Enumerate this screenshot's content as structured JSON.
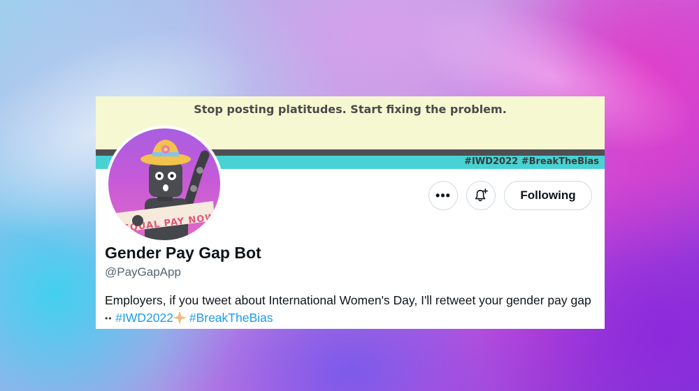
{
  "banner": {
    "headline": "Stop posting platitudes. Start fixing the problem.",
    "hashtags": "#IWD2022 #BreakTheBias"
  },
  "avatar": {
    "sign_text": "EQUAL PAY NOW"
  },
  "actions": {
    "more_label": "•••",
    "following_label": "Following"
  },
  "profile": {
    "display_name": "Gender Pay Gap Bot",
    "handle": "@PayGapApp",
    "bio_text_1": "Employers, if you tweet about International Women's Day, I'll retweet your gender pay gap",
    "bio_eyes": "••",
    "bio_tag_1": "#IWD2022",
    "bio_tag_2": "#BreakTheBias"
  },
  "colors": {
    "link": "#1d9bf0",
    "banner_bg": "#f6f8d2",
    "stripe_teal": "#48d2d4",
    "stripe_dark": "#4e4f52"
  },
  "icons": {
    "more": "ellipsis-icon",
    "bell": "bell-plus-icon",
    "eyes": "eyes-emoji-icon",
    "sparkle": "sparkle-emoji-icon"
  }
}
